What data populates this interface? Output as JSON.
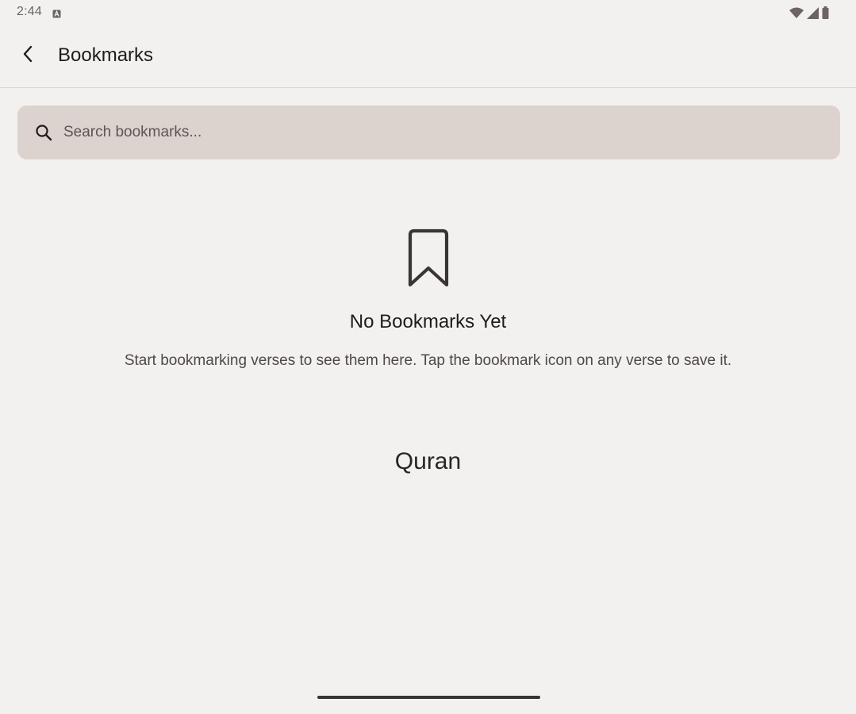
{
  "status_bar": {
    "time": "2:44",
    "icons": [
      "notification-a-icon",
      "wifi-icon",
      "signal-icon",
      "battery-icon"
    ]
  },
  "top_bar": {
    "back_icon": "chevron-left-icon",
    "title": "Bookmarks"
  },
  "search": {
    "icon": "search-icon",
    "placeholder": "Search bookmarks...",
    "value": ""
  },
  "empty_state": {
    "icon": "bookmark-icon",
    "title": "No Bookmarks Yet",
    "description": "Start bookmarking verses to see them here. Tap the bookmark icon on any verse to save it."
  },
  "brand_label": "Quran",
  "colors": {
    "background": "#f3f1ef",
    "search_background": "#dcd2ce",
    "primary_text": "#1f1b19",
    "secondary_text": "#4f4845"
  }
}
